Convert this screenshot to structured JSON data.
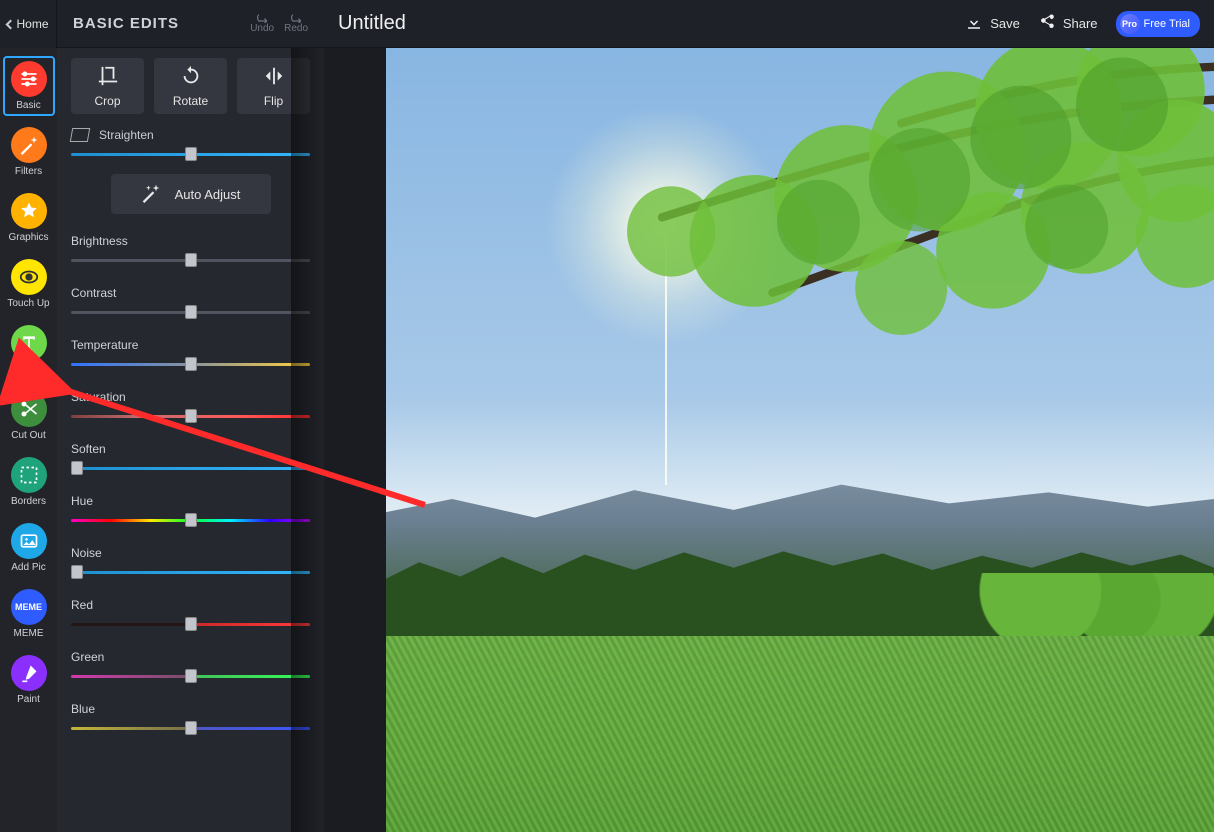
{
  "header": {
    "home": "Home",
    "panel_title": "BASIC EDITS",
    "undo": "Undo",
    "redo": "Redo",
    "doc_title": "Untitled",
    "save": "Save",
    "share": "Share",
    "pro_badge": "Pro",
    "pro_text": "Free Trial"
  },
  "rail": {
    "items": [
      {
        "id": "basic",
        "label": "Basic",
        "color": "#ff3b2f"
      },
      {
        "id": "filters",
        "label": "Filters",
        "color": "#ff7a1a"
      },
      {
        "id": "graphics",
        "label": "Graphics",
        "color": "#ffb300"
      },
      {
        "id": "touchup",
        "label": "Touch Up",
        "color": "#ffe500"
      },
      {
        "id": "text",
        "label": "Text",
        "color": "#6ed84b"
      },
      {
        "id": "cutout",
        "label": "Cut Out",
        "color": "#3d8f3d"
      },
      {
        "id": "borders",
        "label": "Borders",
        "color": "#1fa37a"
      },
      {
        "id": "addpic",
        "label": "Add Pic",
        "color": "#1fa8e7"
      },
      {
        "id": "meme",
        "label": "MEME",
        "color": "#2f5cff"
      },
      {
        "id": "paint",
        "label": "Paint",
        "color": "#8b2fff"
      }
    ],
    "active": "basic",
    "meme_inner": "MEME"
  },
  "panel": {
    "crop": "Crop",
    "rotate": "Rotate",
    "flip": "Flip",
    "straighten": "Straighten",
    "auto_adjust": "Auto Adjust",
    "sliders": [
      {
        "id": "brightness",
        "label": "Brightness",
        "track": "grey",
        "pos": 50
      },
      {
        "id": "contrast",
        "label": "Contrast",
        "track": "grey",
        "pos": 50
      },
      {
        "id": "temperature",
        "label": "Temperature",
        "track": "fire",
        "pos": 50
      },
      {
        "id": "saturation",
        "label": "Saturation",
        "track": "sat",
        "pos": 50
      },
      {
        "id": "soften",
        "label": "Soften",
        "track": "",
        "pos": 2.5
      },
      {
        "id": "hue",
        "label": "Hue",
        "track": "hue",
        "pos": 50
      },
      {
        "id": "noise",
        "label": "Noise",
        "track": "",
        "pos": 2.5
      },
      {
        "id": "red",
        "label": "Red",
        "track": "red",
        "pos": 50
      },
      {
        "id": "green",
        "label": "Green",
        "track": "green",
        "pos": 50
      },
      {
        "id": "blue",
        "label": "Blue",
        "track": "blueg",
        "pos": 50
      }
    ]
  }
}
